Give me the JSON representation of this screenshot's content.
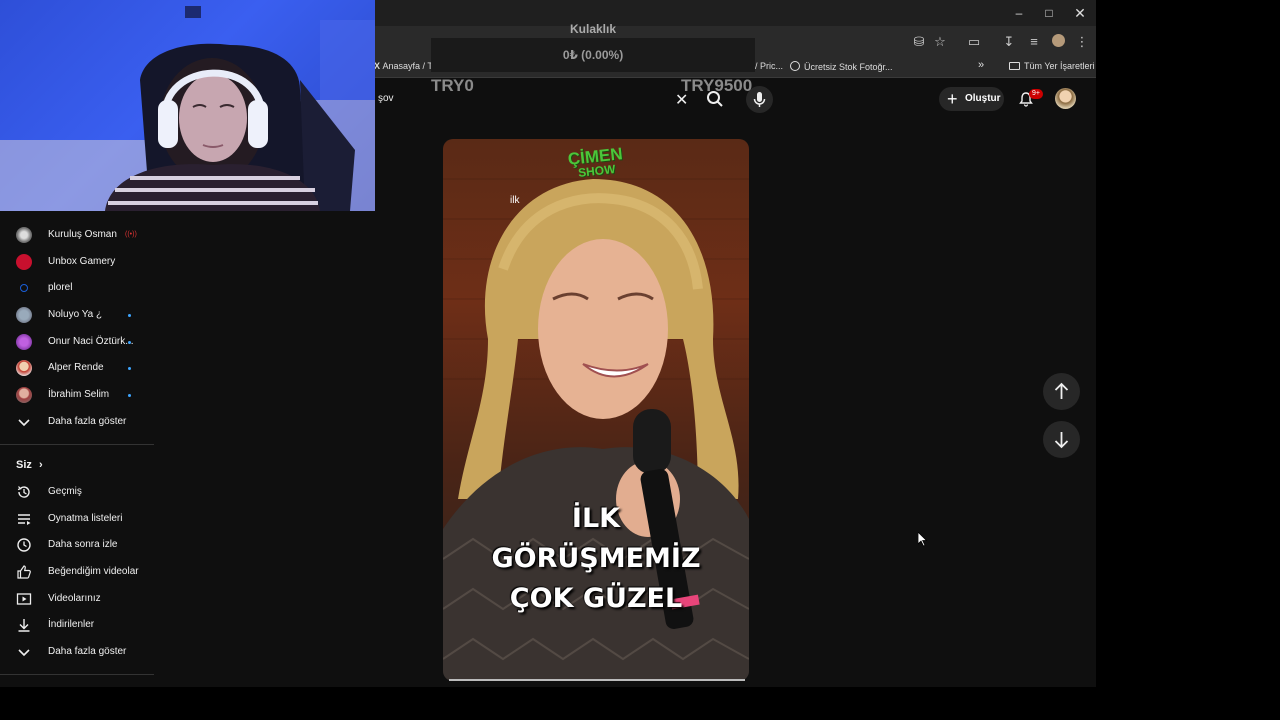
{
  "overlay": {
    "title": "Kulaklık",
    "amount": "0₺ (0.00%)",
    "min": "TRY0",
    "max": "TRY9500"
  },
  "bookmarks": [
    {
      "label": "Anasayfa / Tw"
    },
    {
      "label": "/ Pric..."
    },
    {
      "label": "Ücretsiz Stok Fotoğr..."
    },
    {
      "label": "»"
    },
    {
      "label": "Tüm Yer İşaretleri"
    }
  ],
  "header": {
    "search_value": "şov",
    "create_label": "Oluştur",
    "notification_count": "9+"
  },
  "sidebar": {
    "subscriptions": [
      {
        "label": "Kuruluş Osman",
        "status": "live"
      },
      {
        "label": "Unbox Gamery",
        "status": ""
      },
      {
        "label": "plorel",
        "status": ""
      },
      {
        "label": "Noluyo Ya ¿",
        "status": "new"
      },
      {
        "label": "Onur Naci Öztürk...",
        "status": "new"
      },
      {
        "label": "Alper Rende",
        "status": "new"
      },
      {
        "label": "İbrahim Selim",
        "status": "new"
      }
    ],
    "show_more_1": "Daha fazla göster",
    "you_heading": "Siz",
    "you_items": [
      {
        "label": "Geçmiş",
        "icon": "history-icon"
      },
      {
        "label": "Oynatma listeleri",
        "icon": "playlist-icon"
      },
      {
        "label": "Daha sonra izle",
        "icon": "watch-later-icon"
      },
      {
        "label": "Beğendiğim videolar",
        "icon": "like-icon"
      },
      {
        "label": "Videolarınız",
        "icon": "your-videos-icon"
      },
      {
        "label": "İndirilenler",
        "icon": "download-icon"
      }
    ],
    "show_more_2": "Daha fazla göster"
  },
  "short": {
    "logo_line1": "ÇİMEN",
    "logo_line2": "SHOW",
    "small_caption": "ilk",
    "caption_lines": [
      "İLK",
      "GÖRÜŞMEMİZ",
      "ÇOK GÜZEL"
    ]
  },
  "colors": {
    "accent_red": "#cc0000",
    "new_dot": "#3ea6ff",
    "logo_green": "#4cc63a"
  }
}
